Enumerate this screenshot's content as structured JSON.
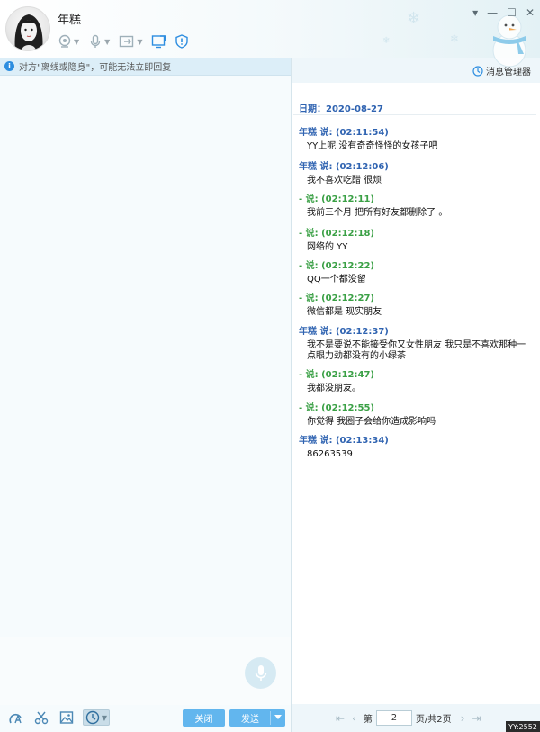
{
  "window": {
    "title": "年糕",
    "controls": [
      "dropdown-icon",
      "minimize-icon",
      "maximize-icon",
      "close-icon"
    ]
  },
  "toolbar": {
    "icons": [
      "webcam-icon",
      "microphone-icon",
      "file-transfer-icon",
      "screen-share-icon",
      "shield-icon"
    ]
  },
  "notice": {
    "text": "对方\"离线或隐身\"，可能无法立即回复"
  },
  "history": {
    "manager_label": "消息管理器",
    "date_label": "日期：2020-08-27",
    "messages": [
      {
        "sender": "年糕",
        "header": "年糕 说: (02:11:54)",
        "text": "YY上呢 没有奇奇怪怪的女孩子吧",
        "side": "me"
      },
      {
        "sender": "年糕",
        "header": "年糕 说: (02:12:06)",
        "text": "我不喜欢吃醋 很烦",
        "side": "me"
      },
      {
        "sender": "-",
        "header": "- 说: (02:12:11)",
        "text": "我前三个月 把所有好友都删除了 。",
        "side": "other"
      },
      {
        "sender": "-",
        "header": "- 说: (02:12:18)",
        "text": "网络的 YY",
        "side": "other"
      },
      {
        "sender": "-",
        "header": "- 说: (02:12:22)",
        "text": "QQ一个都没留",
        "side": "other"
      },
      {
        "sender": "-",
        "header": "- 说: (02:12:27)",
        "text": "微信都是 现实朋友",
        "side": "other"
      },
      {
        "sender": "年糕",
        "header": "年糕 说: (02:12:37)",
        "text": "我不是要说不能接受你又女性朋友 我只是不喜欢那种一点眼力劲都没有的小绿茶",
        "side": "me"
      },
      {
        "sender": "-",
        "header": "- 说: (02:12:47)",
        "text": "我都没朋友。",
        "side": "other"
      },
      {
        "sender": "-",
        "header": "- 说: (02:12:55)",
        "text": "你觉得 我圈子会给你造成影响吗",
        "side": "other"
      },
      {
        "sender": "年糕",
        "header": "年糕 说: (02:13:34)",
        "text": "86263539",
        "side": "me"
      }
    ]
  },
  "input": {
    "close_label": "关闭",
    "send_label": "发送",
    "tools": [
      "font-icon",
      "scissors-icon",
      "image-icon",
      "history-clock-icon"
    ]
  },
  "pager": {
    "prefix": "第",
    "current": "2",
    "suffix": "页/共2页"
  },
  "corner_badge": "YY:2552",
  "colors": {
    "self_name": "#2f63b1",
    "other_name": "#3aa045",
    "button": "#62b6ee",
    "notice_bg": "#dceef8"
  }
}
